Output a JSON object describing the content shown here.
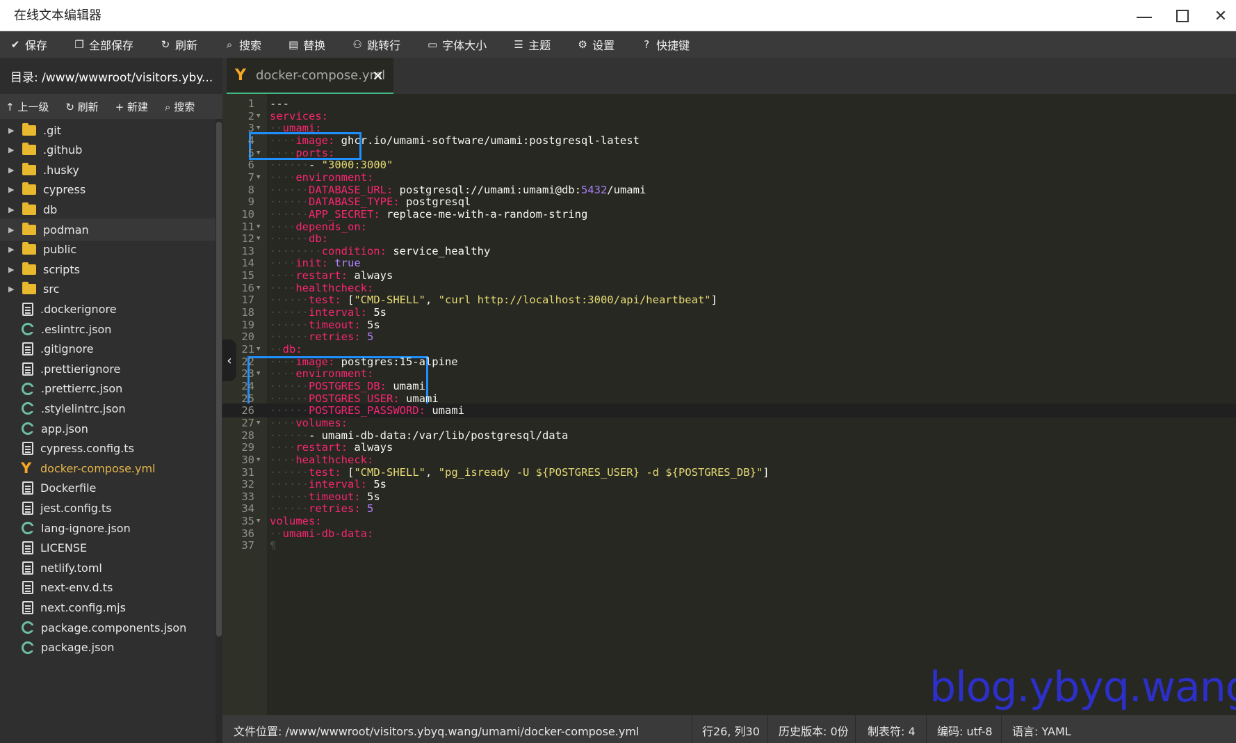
{
  "window": {
    "title": "在线文本编辑器"
  },
  "toolbar": {
    "items": [
      {
        "label": "保存",
        "icon": "✔"
      },
      {
        "label": "全部保存",
        "icon": "❐"
      },
      {
        "label": "刷新",
        "icon": "↻"
      },
      {
        "label": "搜索",
        "icon": "⌕"
      },
      {
        "label": "替换",
        "icon": "▤"
      },
      {
        "label": "跳转行",
        "icon": "⚇"
      },
      {
        "label": "字体大小",
        "icon": "▭"
      },
      {
        "label": "主题",
        "icon": "☰"
      },
      {
        "label": "设置",
        "icon": "⚙"
      },
      {
        "label": "快捷键",
        "icon": "?"
      }
    ]
  },
  "directory": {
    "label": "目录:  /www/wwwroot/visitors.yby..."
  },
  "tab": {
    "name": "docker-compose.yml",
    "icon": "Y"
  },
  "tree_tools": [
    {
      "label": "↑ 上一级"
    },
    {
      "label": "↻ 刷新"
    },
    {
      "label": "+ 新建"
    },
    {
      "label": "⌕ 搜索"
    }
  ],
  "tree": [
    {
      "name": ".git",
      "type": "folder"
    },
    {
      "name": ".github",
      "type": "folder"
    },
    {
      "name": ".husky",
      "type": "folder"
    },
    {
      "name": "cypress",
      "type": "folder"
    },
    {
      "name": "db",
      "type": "folder"
    },
    {
      "name": "podman",
      "type": "folder"
    },
    {
      "name": "public",
      "type": "folder"
    },
    {
      "name": "scripts",
      "type": "folder"
    },
    {
      "name": "src",
      "type": "folder"
    },
    {
      "name": ".dockerignore",
      "type": "file"
    },
    {
      "name": ".eslintrc.json",
      "type": "json"
    },
    {
      "name": ".gitignore",
      "type": "file"
    },
    {
      "name": ".prettierignore",
      "type": "file"
    },
    {
      "name": ".prettierrc.json",
      "type": "json"
    },
    {
      "name": ".stylelintrc.json",
      "type": "json"
    },
    {
      "name": "app.json",
      "type": "json"
    },
    {
      "name": "cypress.config.ts",
      "type": "file"
    },
    {
      "name": "docker-compose.yml",
      "type": "yaml"
    },
    {
      "name": "Dockerfile",
      "type": "file"
    },
    {
      "name": "jest.config.ts",
      "type": "file"
    },
    {
      "name": "lang-ignore.json",
      "type": "json"
    },
    {
      "name": "LICENSE",
      "type": "file"
    },
    {
      "name": "netlify.toml",
      "type": "file"
    },
    {
      "name": "next-env.d.ts",
      "type": "file"
    },
    {
      "name": "next.config.mjs",
      "type": "file"
    },
    {
      "name": "package.components.json",
      "type": "json"
    },
    {
      "name": "package.json",
      "type": "json"
    }
  ],
  "code": [
    {
      "indent": 0,
      "fold": false,
      "parts": [
        [
          "p",
          "---"
        ]
      ]
    },
    {
      "indent": 0,
      "fold": true,
      "parts": [
        [
          "k",
          "services:"
        ]
      ]
    },
    {
      "indent": 1,
      "fold": true,
      "parts": [
        [
          "k",
          "umami:"
        ]
      ]
    },
    {
      "indent": 2,
      "fold": false,
      "parts": [
        [
          "k",
          "image:"
        ],
        [
          "p",
          " ghcr.io/umami-software/umami:postgresql-latest"
        ]
      ]
    },
    {
      "indent": 2,
      "fold": true,
      "parts": [
        [
          "k",
          "ports:"
        ]
      ]
    },
    {
      "indent": 3,
      "fold": false,
      "parts": [
        [
          "p",
          "- "
        ],
        [
          "s",
          "\"3000:3000\""
        ]
      ]
    },
    {
      "indent": 2,
      "fold": true,
      "parts": [
        [
          "k",
          "environment:"
        ]
      ]
    },
    {
      "indent": 3,
      "fold": false,
      "parts": [
        [
          "k",
          "DATABASE_URL:"
        ],
        [
          "p",
          " postgresql://umami:umami@db:"
        ],
        [
          "n",
          "5432"
        ],
        [
          "p",
          "/umami"
        ]
      ]
    },
    {
      "indent": 3,
      "fold": false,
      "parts": [
        [
          "k",
          "DATABASE_TYPE:"
        ],
        [
          "p",
          " postgresql"
        ]
      ]
    },
    {
      "indent": 3,
      "fold": false,
      "parts": [
        [
          "k",
          "APP_SECRET:"
        ],
        [
          "p",
          " replace-me-with-a-random-string"
        ]
      ]
    },
    {
      "indent": 2,
      "fold": true,
      "parts": [
        [
          "k",
          "depends_on:"
        ]
      ]
    },
    {
      "indent": 3,
      "fold": true,
      "parts": [
        [
          "k",
          "db:"
        ]
      ]
    },
    {
      "indent": 4,
      "fold": false,
      "parts": [
        [
          "k",
          "condition:"
        ],
        [
          "p",
          " service_healthy"
        ]
      ]
    },
    {
      "indent": 2,
      "fold": false,
      "parts": [
        [
          "k",
          "init:"
        ],
        [
          "p",
          " "
        ],
        [
          "n",
          "true"
        ]
      ]
    },
    {
      "indent": 2,
      "fold": false,
      "parts": [
        [
          "k",
          "restart:"
        ],
        [
          "p",
          " always"
        ]
      ]
    },
    {
      "indent": 2,
      "fold": true,
      "parts": [
        [
          "k",
          "healthcheck:"
        ]
      ]
    },
    {
      "indent": 3,
      "fold": false,
      "parts": [
        [
          "k",
          "test:"
        ],
        [
          "p",
          " ["
        ],
        [
          "s",
          "\"CMD-SHELL\""
        ],
        [
          "p",
          ", "
        ],
        [
          "s",
          "\"curl http://localhost:3000/api/heartbeat\""
        ],
        [
          "p",
          "]"
        ]
      ]
    },
    {
      "indent": 3,
      "fold": false,
      "parts": [
        [
          "k",
          "interval:"
        ],
        [
          "p",
          " 5s"
        ]
      ]
    },
    {
      "indent": 3,
      "fold": false,
      "parts": [
        [
          "k",
          "timeout:"
        ],
        [
          "p",
          " 5s"
        ]
      ]
    },
    {
      "indent": 3,
      "fold": false,
      "parts": [
        [
          "k",
          "retries:"
        ],
        [
          "p",
          " "
        ],
        [
          "n",
          "5"
        ]
      ]
    },
    {
      "indent": 1,
      "fold": true,
      "parts": [
        [
          "k",
          "db:"
        ]
      ]
    },
    {
      "indent": 2,
      "fold": false,
      "parts": [
        [
          "k",
          "image:"
        ],
        [
          "p",
          " postgres:15-alpine"
        ]
      ]
    },
    {
      "indent": 2,
      "fold": true,
      "parts": [
        [
          "k",
          "environment:"
        ]
      ]
    },
    {
      "indent": 3,
      "fold": false,
      "parts": [
        [
          "k",
          "POSTGRES_DB:"
        ],
        [
          "p",
          " umami"
        ]
      ]
    },
    {
      "indent": 3,
      "fold": false,
      "parts": [
        [
          "k",
          "POSTGRES_USER:"
        ],
        [
          "p",
          " umami"
        ]
      ]
    },
    {
      "indent": 3,
      "fold": false,
      "parts": [
        [
          "k",
          "POSTGRES_PASSWORD:"
        ],
        [
          "p",
          " umami"
        ]
      ]
    },
    {
      "indent": 2,
      "fold": true,
      "parts": [
        [
          "k",
          "volumes:"
        ]
      ]
    },
    {
      "indent": 3,
      "fold": false,
      "parts": [
        [
          "p",
          "- umami-db-data:/var/lib/postgresql/data"
        ]
      ]
    },
    {
      "indent": 2,
      "fold": false,
      "parts": [
        [
          "k",
          "restart:"
        ],
        [
          "p",
          " always"
        ]
      ]
    },
    {
      "indent": 2,
      "fold": true,
      "parts": [
        [
          "k",
          "healthcheck:"
        ]
      ]
    },
    {
      "indent": 3,
      "fold": false,
      "parts": [
        [
          "k",
          "test:"
        ],
        [
          "p",
          " ["
        ],
        [
          "s",
          "\"CMD-SHELL\""
        ],
        [
          "p",
          ", "
        ],
        [
          "s",
          "\"pg_isready -U ${POSTGRES_USER} -d ${POSTGRES_DB}\""
        ],
        [
          "p",
          "]"
        ]
      ]
    },
    {
      "indent": 3,
      "fold": false,
      "parts": [
        [
          "k",
          "interval:"
        ],
        [
          "p",
          " 5s"
        ]
      ]
    },
    {
      "indent": 3,
      "fold": false,
      "parts": [
        [
          "k",
          "timeout:"
        ],
        [
          "p",
          " 5s"
        ]
      ]
    },
    {
      "indent": 3,
      "fold": false,
      "parts": [
        [
          "k",
          "retries:"
        ],
        [
          "p",
          " "
        ],
        [
          "n",
          "5"
        ]
      ]
    },
    {
      "indent": 0,
      "fold": true,
      "parts": [
        [
          "k",
          "volumes:"
        ]
      ]
    },
    {
      "indent": 1,
      "fold": false,
      "parts": [
        [
          "k",
          "umami-db-data:"
        ]
      ]
    },
    {
      "indent": 0,
      "fold": false,
      "parts": [
        [
          "ws",
          "¶"
        ]
      ]
    }
  ],
  "active_line": 26,
  "watermark": "blog.ybyq.wang",
  "status": {
    "path": "文件位置:  /www/wwwroot/visitors.ybyq.wang/umami/docker-compose.yml",
    "position": "行26,  列30",
    "history": "历史版本:  0份",
    "tabsize": "制表符:  4",
    "encoding": "编码:  utf-8",
    "language": "语言:  YAML"
  },
  "colors": {
    "highlight_box": "#1e90ff",
    "accent_tab": "#41b883"
  }
}
